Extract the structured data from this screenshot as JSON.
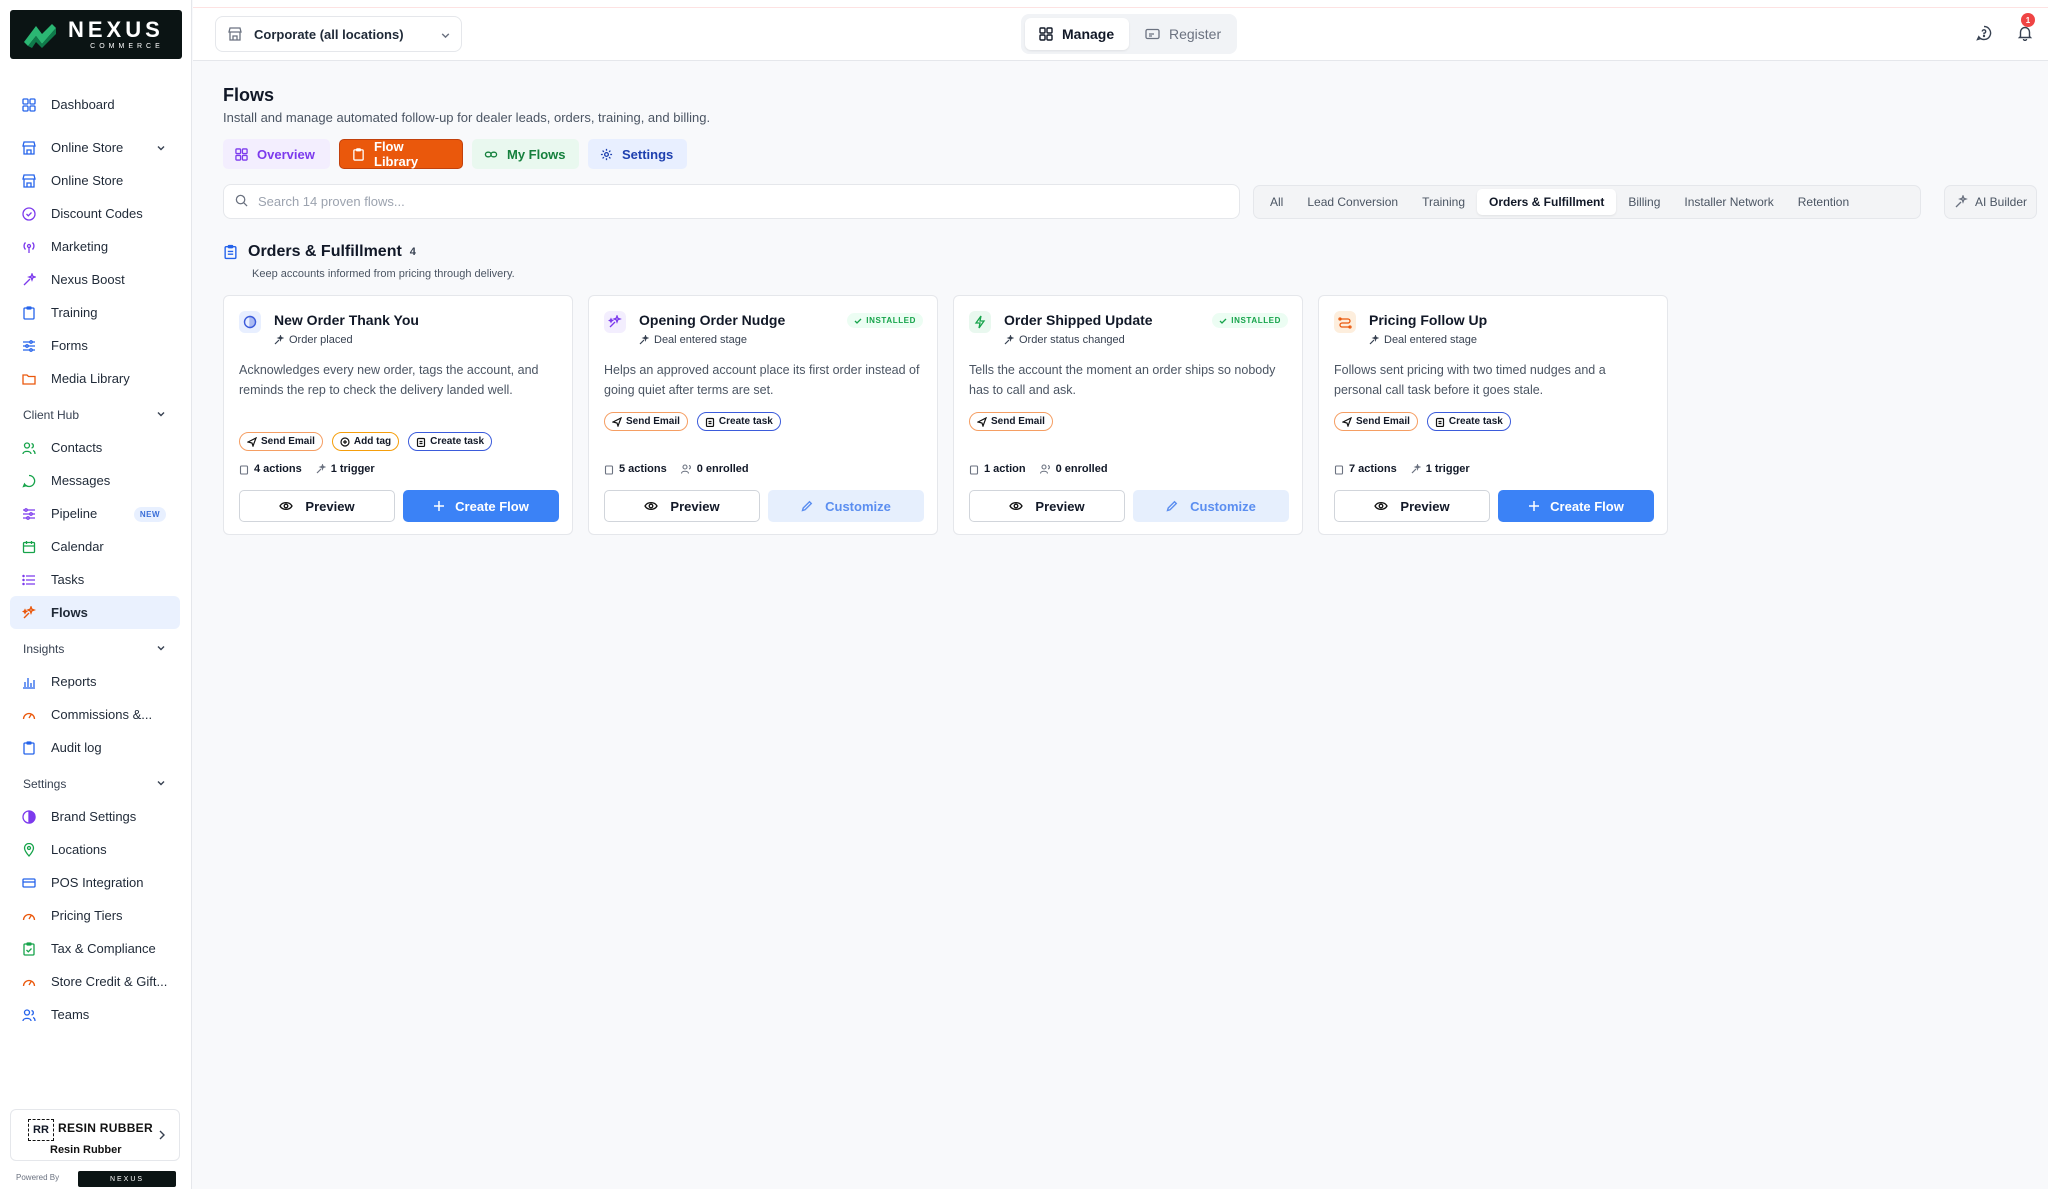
{
  "brand": {
    "wordmark": "NEXUS",
    "tagline": "COMMERCE",
    "powered_by": "Powered By"
  },
  "sidebar": {
    "items": [
      {
        "label": "Dashboard"
      },
      {
        "label": "Online Store"
      },
      {
        "label": "Online Store"
      },
      {
        "label": "Discount Codes"
      },
      {
        "label": "Marketing"
      },
      {
        "label": "Nexus Boost"
      },
      {
        "label": "Training"
      },
      {
        "label": "Forms"
      },
      {
        "label": "Media Library"
      }
    ],
    "sections": {
      "client_hub": "Client Hub",
      "insights": "Insights",
      "settings": "Settings"
    },
    "client_hub_items": [
      {
        "label": "Contacts"
      },
      {
        "label": "Messages"
      },
      {
        "label": "Pipeline",
        "badge": "NEW"
      },
      {
        "label": "Calendar"
      },
      {
        "label": "Tasks"
      },
      {
        "label": "Flows"
      }
    ],
    "insights_items": [
      {
        "label": "Reports"
      },
      {
        "label": "Commissions &..."
      },
      {
        "label": "Audit log"
      }
    ],
    "settings_items": [
      {
        "label": "Brand Settings"
      },
      {
        "label": "Locations"
      },
      {
        "label": "POS Integration"
      },
      {
        "label": "Pricing Tiers"
      },
      {
        "label": "Tax & Compliance"
      },
      {
        "label": "Store Credit & Gift..."
      },
      {
        "label": "Teams"
      }
    ],
    "account": {
      "logo_text": "RR",
      "name": "RESIN RUBBER",
      "sub": "Resin Rubber"
    }
  },
  "topbar": {
    "location": "Corporate (all locations)",
    "modes": {
      "manage": "Manage",
      "register": "Register"
    },
    "notification_count": "1"
  },
  "page": {
    "title": "Flows",
    "subtitle": "Install and manage automated follow-up for dealer leads, orders, training, and billing.",
    "tabs": {
      "overview": "Overview",
      "library": "Flow Library",
      "myflows": "My Flows",
      "settings": "Settings"
    },
    "search_placeholder": "Search 14 proven flows...",
    "filters": [
      "All",
      "Lead Conversion",
      "Training",
      "Orders & Fulfillment",
      "Billing",
      "Installer Network",
      "Retention"
    ],
    "ai_builder": "AI Builder",
    "section": {
      "title": "Orders & Fulfillment",
      "count": "4",
      "subtitle": "Keep accounts informed from pricing through delivery."
    }
  },
  "cards": [
    {
      "title": "New Order Thank You",
      "trigger": "Order placed",
      "description": "Acknowledges every new order, tags the account, and reminds the rep to check the delivery landed well.",
      "chips": [
        "Send Email",
        "Add tag",
        "Create task"
      ],
      "actions": "4 actions",
      "meta2": "1 trigger",
      "preview": "Preview",
      "primary": "Create Flow"
    },
    {
      "title": "Opening Order Nudge",
      "installed": "INSTALLED",
      "trigger": "Deal entered stage",
      "description": "Helps an approved account place its first order instead of going quiet after terms are set.",
      "chips": [
        "Send Email",
        "Create task"
      ],
      "actions": "5 actions",
      "meta2": "0 enrolled",
      "preview": "Preview",
      "primary": "Customize"
    },
    {
      "title": "Order Shipped Update",
      "installed": "INSTALLED",
      "trigger": "Order status changed",
      "description": "Tells the account the moment an order ships so nobody has to call and ask.",
      "chips": [
        "Send Email"
      ],
      "actions": "1 action",
      "meta2": "0 enrolled",
      "preview": "Preview",
      "primary": "Customize"
    },
    {
      "title": "Pricing Follow Up",
      "trigger": "Deal entered stage",
      "description": "Follows sent pricing with two timed nudges and a personal call task before it goes stale.",
      "chips": [
        "Send Email",
        "Create task"
      ],
      "actions": "7 actions",
      "meta2": "1 trigger",
      "preview": "Preview",
      "primary": "Create Flow"
    }
  ],
  "colors": {
    "accent": "#ea580c",
    "primary": "#3b82f6",
    "active_nav": "#eaf1fe",
    "success": "#16a34a"
  }
}
